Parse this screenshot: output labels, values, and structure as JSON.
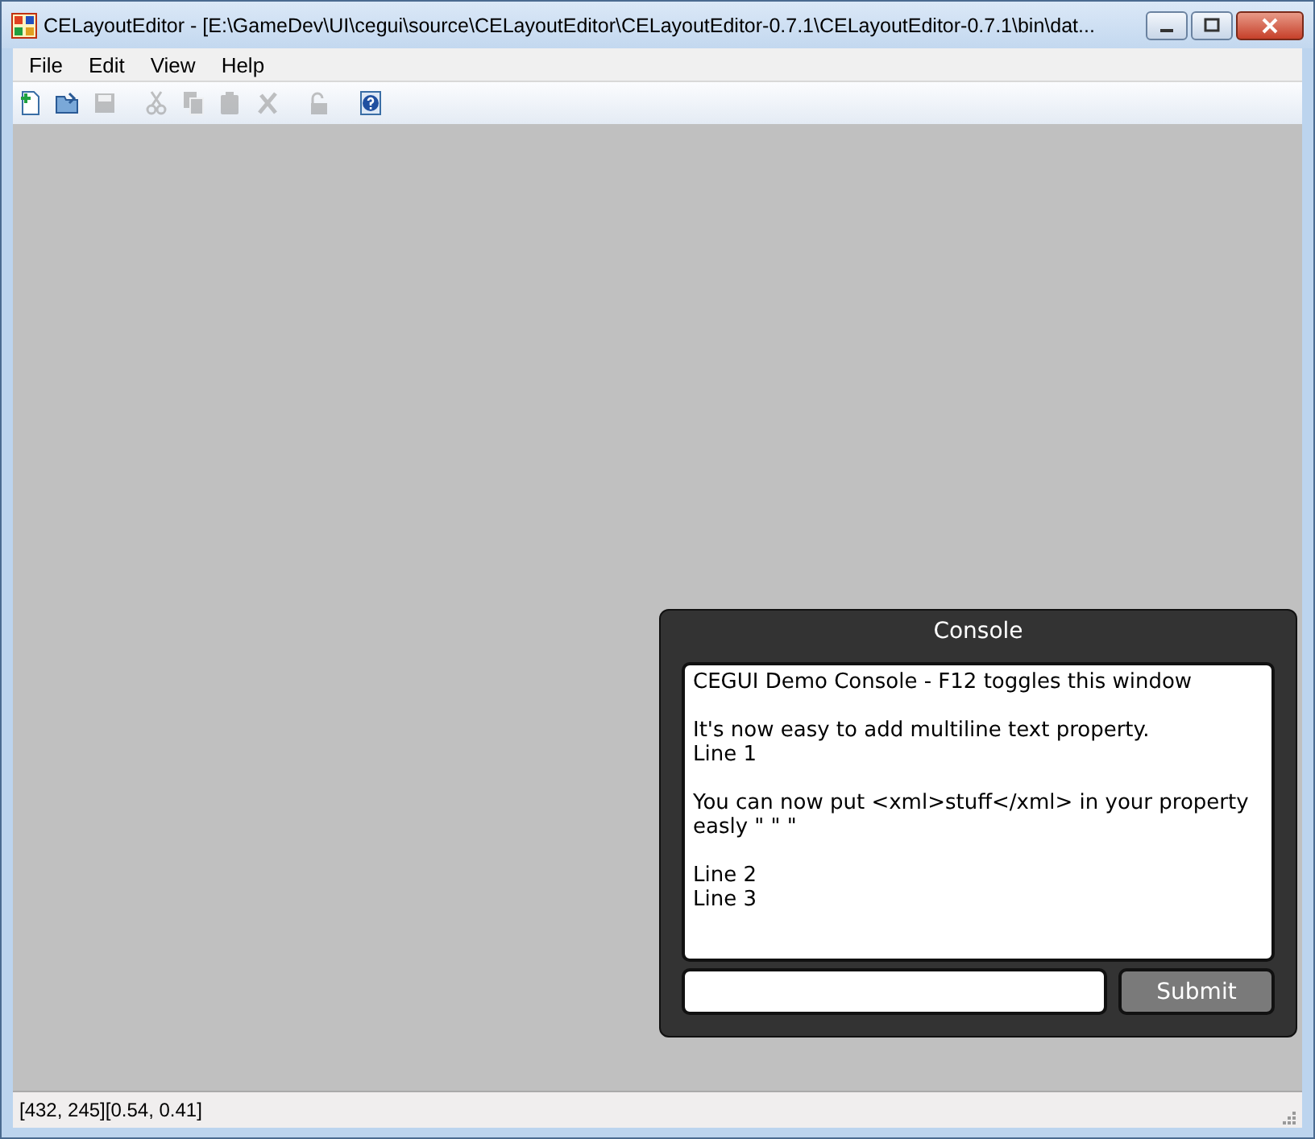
{
  "window": {
    "title": "CELayoutEditor - [E:\\GameDev\\UI\\cegui\\source\\CELayoutEditor\\CELayoutEditor-0.7.1\\CELayoutEditor-0.7.1\\bin\\dat..."
  },
  "menu": [
    "File",
    "Edit",
    "View",
    "Help"
  ],
  "toolbar": [
    {
      "kind": "new",
      "disabled": false
    },
    {
      "kind": "open",
      "disabled": false
    },
    {
      "kind": "save",
      "disabled": true
    },
    {
      "kind": "cut",
      "disabled": true
    },
    {
      "kind": "copy",
      "disabled": true
    },
    {
      "kind": "paste",
      "disabled": true
    },
    {
      "kind": "delete",
      "disabled": true
    },
    {
      "kind": "lock",
      "disabled": true
    },
    {
      "kind": "help",
      "disabled": false
    }
  ],
  "console": {
    "title": "Console",
    "paragraphs": [
      [
        "CEGUI Demo Console - F12 toggles this window"
      ],
      [
        "It's now easy to add multiline text property.",
        "Line 1"
      ],
      [
        "You can now put <xml>stuff</xml> in your property easly \" \" \""
      ],
      [
        "Line 2",
        "Line 3"
      ]
    ],
    "submit": "Submit"
  },
  "status_bar": "[432, 245][0.54, 0.41]"
}
